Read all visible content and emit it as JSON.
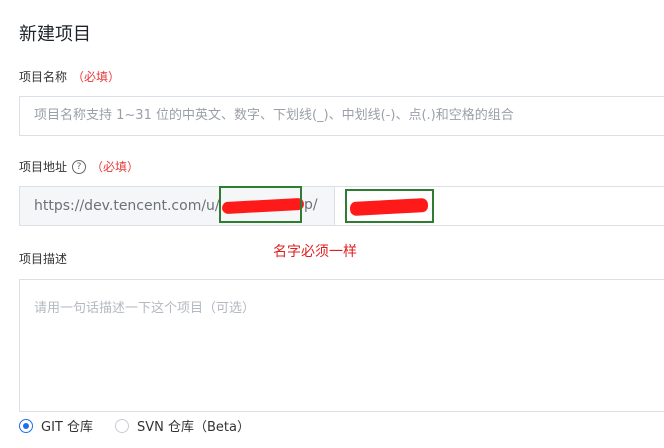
{
  "page_title": "新建项目",
  "project_name": {
    "label": "项目名称",
    "required": "（必填）",
    "placeholder": "项目名称支持 1~31 位的中英文、数字、下划线(_)、中划线(-)、点(.)和空格的组合"
  },
  "project_address": {
    "label": "项目地址",
    "help_icon": "question-circle-icon",
    "required": "（必填）",
    "prefix": "https://dev.tencent.com/u/",
    "prefix_tail": "p/",
    "value": ""
  },
  "annotation": "名字必须一样",
  "project_description": {
    "label": "项目描述",
    "placeholder": "请用一句话描述一下这个项目（可选）"
  },
  "repository_type": {
    "options": [
      {
        "label": "GIT 仓库",
        "checked": true
      },
      {
        "label": "SVN 仓库（Beta）",
        "checked": false
      }
    ]
  },
  "colors": {
    "required": "#e63b3b",
    "annotation": "#e02020",
    "highlight_box": "#2f7d32",
    "redaction": "#ff1a1a",
    "radio_accent": "#1f6feb"
  }
}
